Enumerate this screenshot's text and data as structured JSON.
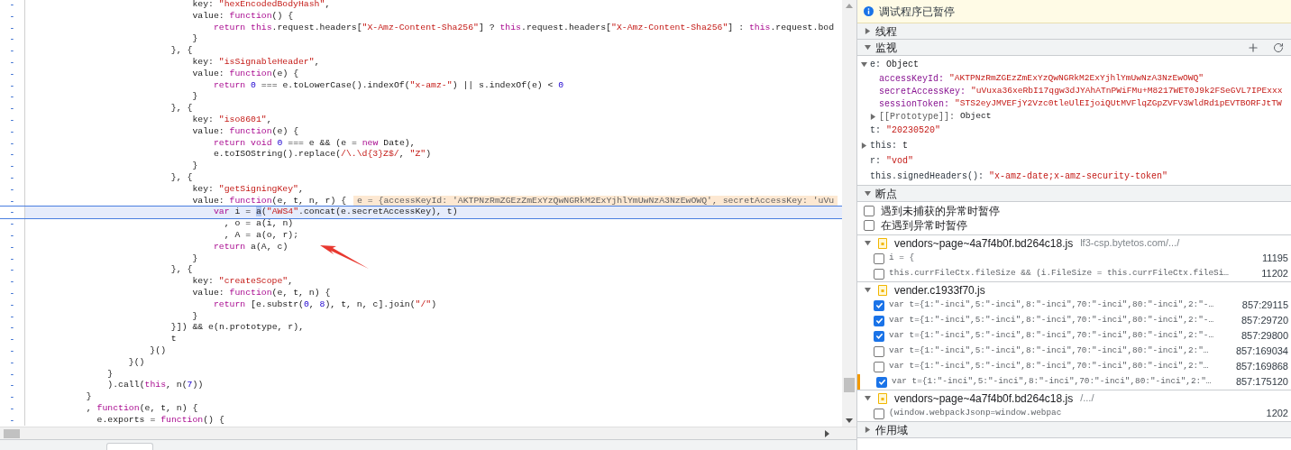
{
  "code_editor": {
    "lines": [
      {
        "marker": "-",
        "text": "                              key: \"hexEncodedBodyHash\",",
        "current": false
      },
      {
        "marker": "-",
        "text": "                              value: function() {",
        "current": false
      },
      {
        "marker": "-",
        "text": "                                  return this.request.headers[\"X-Amz-Content-Sha256\"] ? this.request.headers[\"X-Amz-Content-Sha256\"] : this.request.bod",
        "current": false
      },
      {
        "marker": "-",
        "text": "                              }",
        "current": false
      },
      {
        "marker": "-",
        "text": "                          }, {",
        "current": false
      },
      {
        "marker": "-",
        "text": "                              key: \"isSignableHeader\",",
        "current": false
      },
      {
        "marker": "-",
        "text": "                              value: function(e) {",
        "current": false
      },
      {
        "marker": "-",
        "text": "                                  return 0 === e.toLowerCase().indexOf(\"x-amz-\") || s.indexOf(e) < 0",
        "current": false
      },
      {
        "marker": "-",
        "text": "                              }",
        "current": false
      },
      {
        "marker": "-",
        "text": "                          }, {",
        "current": false
      },
      {
        "marker": "-",
        "text": "                              key: \"iso8601\",",
        "current": false
      },
      {
        "marker": "-",
        "text": "                              value: function(e) {",
        "current": false
      },
      {
        "marker": "-",
        "text": "                                  return void 0 === e && (e = new Date),",
        "current": false
      },
      {
        "marker": "-",
        "text": "                                  e.toISOString().replace(/\\.\\d{3}Z$/, \"Z\")",
        "current": false
      },
      {
        "marker": "-",
        "text": "                              }",
        "current": false
      },
      {
        "marker": "-",
        "text": "                          }, {",
        "current": false
      },
      {
        "marker": "-",
        "text": "                              key: \"getSigningKey\",",
        "current": false
      },
      {
        "marker": "-",
        "text": "                              value: function(e, t, n, r) {",
        "current": false,
        "inline_value": "e = {accessKeyId: 'AKTPNzRmZGEzZmExYzQwNGRkM2ExYjhlYmUwNzA3NzEwOWQ', secretAccessKey: 'uVu"
      },
      {
        "marker": "-",
        "text": "                                  var i = ",
        "selected_text": "a",
        "text_after": "(\"AWS4\".concat(e.secretAccessKey), t)",
        "current": true
      },
      {
        "marker": "-",
        "text": "                                    , o = a(i, n)",
        "current": false
      },
      {
        "marker": "-",
        "text": "                                    , A = a(o, r);",
        "current": false
      },
      {
        "marker": "-",
        "text": "                                  return a(A, c)",
        "current": false
      },
      {
        "marker": "-",
        "text": "                              }",
        "current": false
      },
      {
        "marker": "-",
        "text": "                          }, {",
        "current": false
      },
      {
        "marker": "-",
        "text": "                              key: \"createScope\",",
        "current": false
      },
      {
        "marker": "-",
        "text": "                              value: function(e, t, n) {",
        "current": false
      },
      {
        "marker": "-",
        "text": "                                  return [e.substr(0, 8), t, n, c].join(\"/\")",
        "current": false
      },
      {
        "marker": "-",
        "text": "                              }",
        "current": false
      },
      {
        "marker": "-",
        "text": "                          }]) && e(n.prototype, r),",
        "current": false
      },
      {
        "marker": "-",
        "text": "                          t",
        "current": false
      },
      {
        "marker": "-",
        "text": "                      }()",
        "current": false
      },
      {
        "marker": "-",
        "text": "                  }()",
        "current": false
      },
      {
        "marker": "-",
        "text": "              }",
        "current": false
      },
      {
        "marker": "-",
        "text": "              ).call(this, n(7))",
        "current": false
      },
      {
        "marker": "-",
        "text": "          }",
        "current": false
      },
      {
        "marker": "-",
        "text": "          , function(e, t, n) {",
        "current": false
      },
      {
        "marker": "-",
        "text": "            e.exports = function() {",
        "current": false
      }
    ]
  },
  "paused_banner": {
    "text": "调试程序已暂停"
  },
  "threads_section": {
    "title": "线程",
    "expanded": false
  },
  "watch_section": {
    "title": "监视",
    "expanded": true,
    "items": [
      {
        "name": "e:",
        "value": "Object",
        "kind": "object",
        "expanded": true,
        "children": [
          {
            "name": "accessKeyId:",
            "value": "\"AKTPNzRmZGEzZmExYzQwNGRkM2ExYjhlYmUwNzA3NzEwOWQ\"",
            "kind": "string"
          },
          {
            "name": "secretAccessKey:",
            "value": "\"uVuxa36xeRbI17qgw3dJYAhATnPWiFMu+M8217WET0J9k2FSeGVL7IPExxx",
            "kind": "string"
          },
          {
            "name": "sessionToken:",
            "value": "\"STS2eyJMVEFjY2Vzc0tleUlEIjoiQUtMVFlqZGpZVFV3WldRd1pEVTBORFJtTW",
            "kind": "string"
          },
          {
            "name": "[[Prototype]]:",
            "value": "Object",
            "kind": "object",
            "expanded": false
          }
        ]
      },
      {
        "name": "t:",
        "value": "\"20230520\"",
        "kind": "string"
      },
      {
        "name": "this:",
        "value": "t",
        "kind": "object",
        "expanded": false
      },
      {
        "name": "r:",
        "value": "\"vod\"",
        "kind": "string"
      },
      {
        "name": "this.signedHeaders():",
        "value": "\"x-amz-date;x-amz-security-token\"",
        "kind": "string"
      }
    ]
  },
  "breakpoints_section": {
    "title": "断点",
    "expanded": true,
    "options": [
      {
        "label": "遇到未捕获的异常时暂停",
        "checked": false
      },
      {
        "label": "在遇到异常时暂停",
        "checked": false
      }
    ],
    "files": [
      {
        "name": "vendors~page~4a7f4b0f.bd264c18.js",
        "path": "lf3-csp.bytetos.com/.../",
        "expanded": true,
        "breakpoints": [
          {
            "code": "i = {",
            "line": "11195",
            "checked": false,
            "current": false
          },
          {
            "code": "this.currFileCtx.fileSize && (i.FileSize = this.currFileCtx.fileSi…",
            "line": "11202",
            "checked": false,
            "current": false
          }
        ]
      },
      {
        "name": "vender.c1933f70.js",
        "expanded": true,
        "breakpoints": [
          {
            "code": "var t={1:\"-inci\",5:\"-inci\",8:\"-inci\",70:\"-inci\",80:\"-inci\",2:\"-…",
            "line": "857:29115",
            "checked": true,
            "current": false
          },
          {
            "code": "var t={1:\"-inci\",5:\"-inci\",8:\"-inci\",70:\"-inci\",80:\"-inci\",2:\"-…",
            "line": "857:29720",
            "checked": true,
            "current": false
          },
          {
            "code": "var t={1:\"-inci\",5:\"-inci\",8:\"-inci\",70:\"-inci\",80:\"-inci\",2:\"-…",
            "line": "857:29800",
            "checked": true,
            "current": false
          },
          {
            "code": "var t={1:\"-inci\",5:\"-inci\",8:\"-inci\",70:\"-inci\",80:\"-inci\",2:\"…",
            "line": "857:169034",
            "checked": false,
            "current": false
          },
          {
            "code": "var t={1:\"-inci\",5:\"-inci\",8:\"-inci\",70:\"-inci\",80:\"-inci\",2:\"…",
            "line": "857:169868",
            "checked": false,
            "current": false
          },
          {
            "code": "var t={1:\"-inci\",5:\"-inci\",8:\"-inci\",70:\"-inci\",80:\"-inci\",2:\"…",
            "line": "857:175120",
            "checked": true,
            "current": true
          }
        ]
      },
      {
        "name": "vendors~page~4a7f4b0f.bd264c18.js",
        "path": "/.../",
        "expanded": true,
        "breakpoints": [
          {
            "code": "(window.webpackJsonp=window.webpac",
            "line": "1202",
            "checked": false,
            "current": false
          }
        ]
      }
    ]
  },
  "scope_section": {
    "title": "作用域",
    "expanded": false
  }
}
